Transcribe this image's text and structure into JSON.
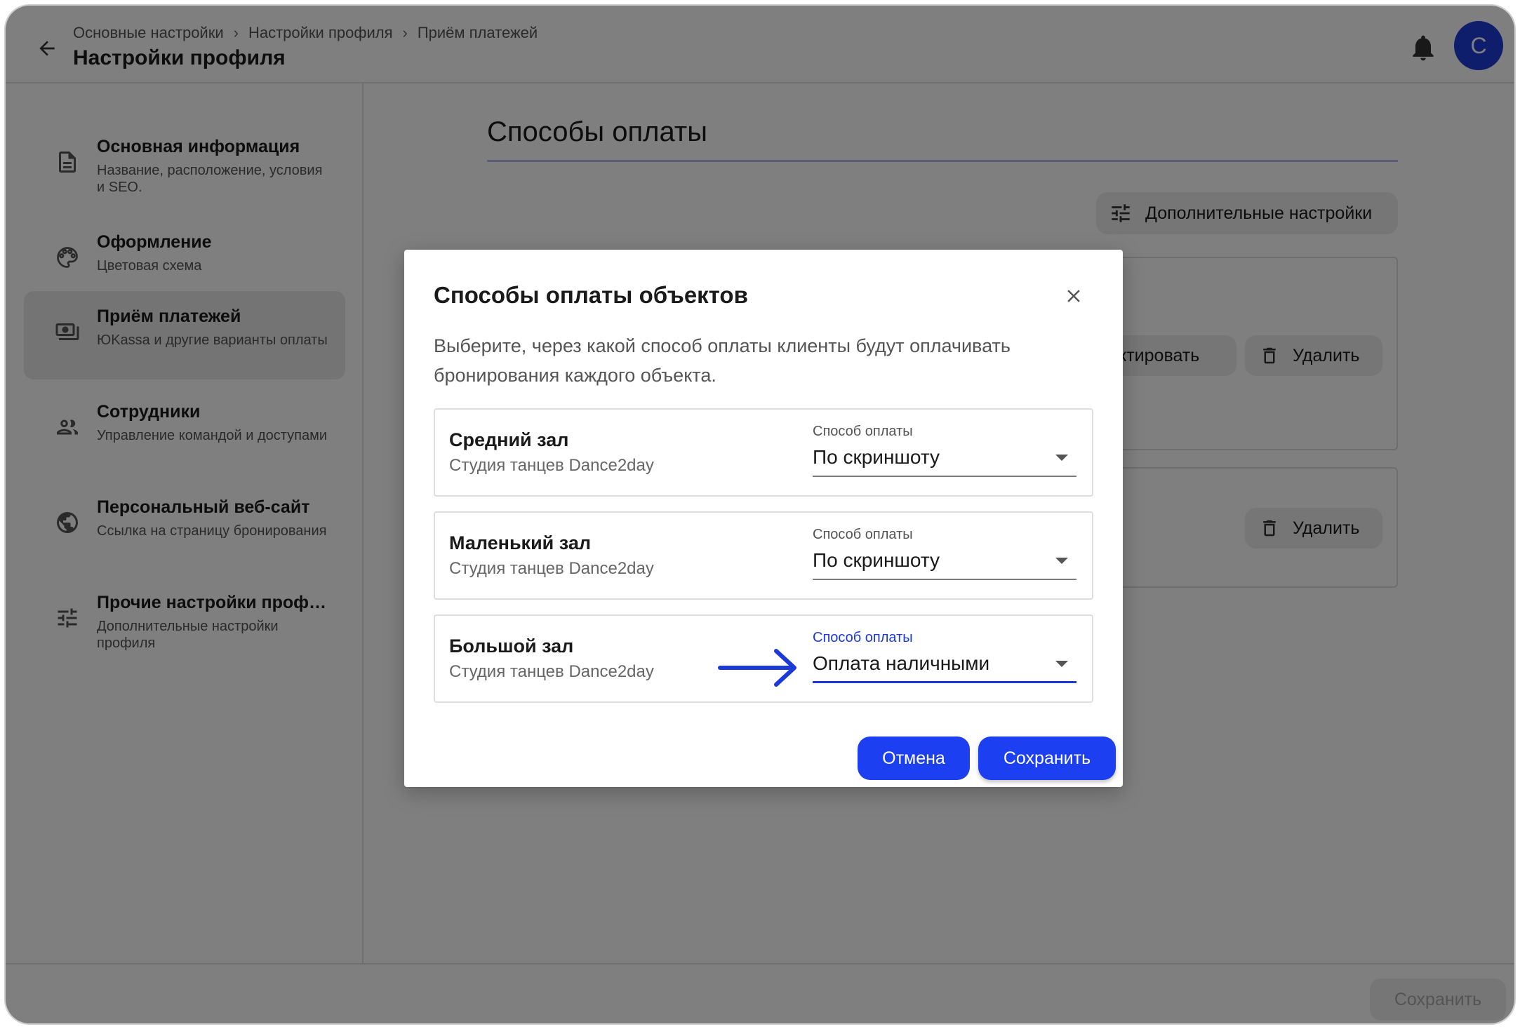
{
  "header": {
    "breadcrumb": [
      "Основные настройки",
      "Настройки профиля",
      "Приём платежей"
    ],
    "title": "Настройки профиля",
    "avatar_letter": "C"
  },
  "sidebar": {
    "items": [
      {
        "title": "Основная информация",
        "desc": "Название, расположение, условия и SEO.",
        "icon": "document-icon"
      },
      {
        "title": "Оформление",
        "desc": "Цветовая схема",
        "icon": "palette-icon"
      },
      {
        "title": "Приём платежей",
        "desc": "ЮKassa и другие варианты оплаты",
        "icon": "payments-icon"
      },
      {
        "title": "Сотрудники",
        "desc": "Управление командой и доступами",
        "icon": "people-icon"
      },
      {
        "title": "Персональный веб-сайт",
        "desc": "Ссылка на страницу бронирования",
        "icon": "globe-icon"
      },
      {
        "title": "Прочие настройки проф…",
        "desc": "Дополнительные настройки профиля",
        "icon": "tune-icon"
      }
    ]
  },
  "main": {
    "section_title": "Способы оплаты",
    "advanced_button": "Дополнительные настройки",
    "edit_button": "ктировать",
    "delete_button": "Удалить"
  },
  "footer": {
    "save": "Сохранить"
  },
  "modal": {
    "title": "Способы оплаты объектов",
    "description": "Выберите, через какой способ оплаты клиенты будут оплачивать бронирования каждого объекта.",
    "rows": [
      {
        "name": "Средний зал",
        "studio": "Студия танцев Dance2day",
        "label": "Способ оплаты",
        "value": "По скриншоту"
      },
      {
        "name": "Маленький зал",
        "studio": "Студия танцев Dance2day",
        "label": "Способ оплаты",
        "value": "По скриншоту"
      },
      {
        "name": "Большой зал",
        "studio": "Студия танцев Dance2day",
        "label": "Способ оплаты",
        "value": "Оплата наличными"
      }
    ],
    "cancel": "Отмена",
    "save": "Сохранить"
  },
  "colors": {
    "accent": "#1c3ff2",
    "avatar": "#1d3ad8",
    "overlay": "rgba(0,0,0,0.5)"
  }
}
